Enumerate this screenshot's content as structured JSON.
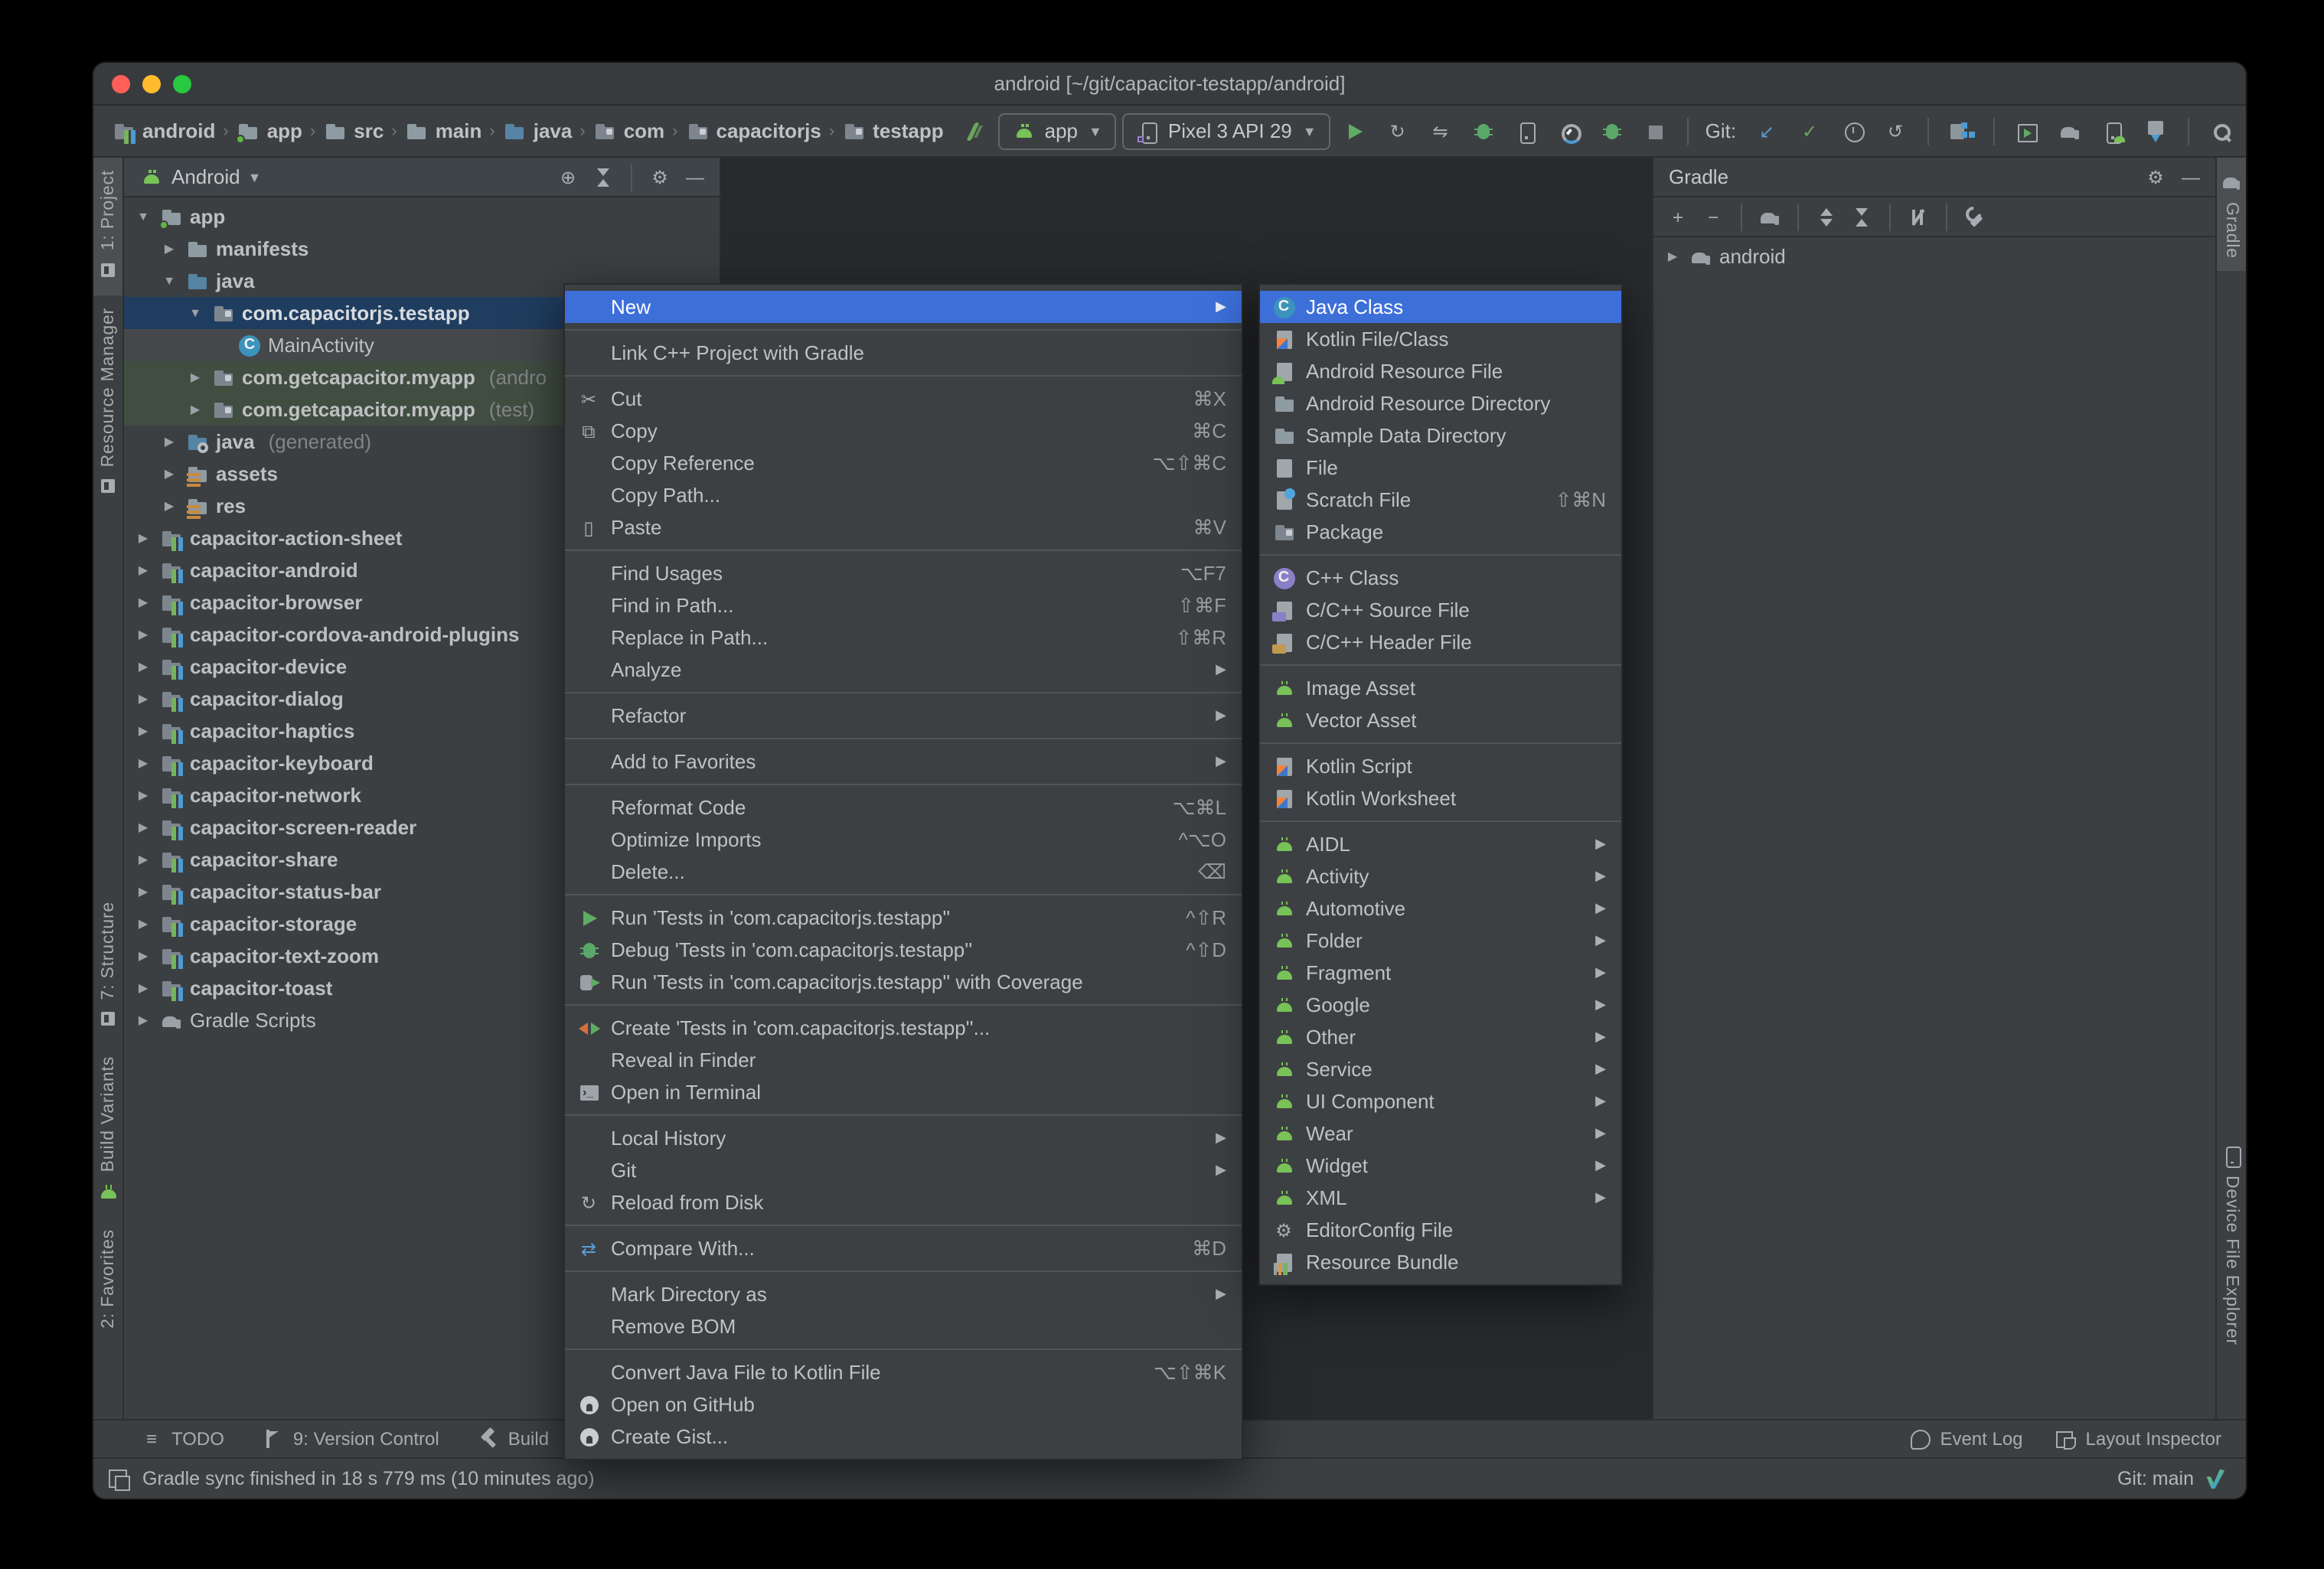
{
  "window": {
    "title": "android [~/git/capacitor-testapp/android]"
  },
  "toolbar": {
    "breadcrumbs": [
      {
        "label": "android",
        "icon": "module"
      },
      {
        "label": "app",
        "icon": "folder-run"
      },
      {
        "label": "src",
        "icon": "folder"
      },
      {
        "label": "main",
        "icon": "folder"
      },
      {
        "label": "java",
        "icon": "folder-src"
      },
      {
        "label": "com",
        "icon": "package"
      },
      {
        "label": "capacitorjs",
        "icon": "package"
      },
      {
        "label": "testapp",
        "icon": "package"
      }
    ],
    "run_config": {
      "label": "app",
      "icon": "android-head"
    },
    "device": {
      "label": "Pixel 3 API 29",
      "icon": "phone-virtual"
    },
    "run_icons": [
      {
        "name": "run",
        "icon": "play"
      },
      {
        "name": "apply-changes",
        "icon": "apply-changes"
      },
      {
        "name": "apply-code-changes",
        "icon": "apply-code-changes"
      },
      {
        "name": "debug",
        "icon": "bug"
      },
      {
        "name": "attach-debugger",
        "icon": "attach-debugger"
      },
      {
        "name": "profile",
        "icon": "profiler"
      },
      {
        "name": "profile-low-overhead",
        "icon": "bug"
      },
      {
        "name": "stop",
        "icon": "stop"
      }
    ],
    "git_label": "Git:",
    "vcs_icons": [
      {
        "name": "update-project",
        "icon": "arrow-down-left"
      },
      {
        "name": "commit",
        "icon": "check"
      },
      {
        "name": "history",
        "icon": "clock"
      },
      {
        "name": "rollback",
        "icon": "undo"
      }
    ],
    "structure_icon": {
      "name": "project-structure",
      "icon": "project-structure"
    },
    "manage_icons": [
      {
        "name": "avd-manager",
        "icon": "avd"
      },
      {
        "name": "sync-project-with-gradle",
        "icon": "elephant"
      },
      {
        "name": "device-manager",
        "icon": "device-manager"
      },
      {
        "name": "sdk-manager",
        "icon": "sdk"
      }
    ],
    "search": {
      "name": "search-everywhere",
      "icon": "search"
    },
    "avatar": {
      "name": "profile-avatar",
      "icon": "avatar"
    }
  },
  "left_stripe": {
    "top": [
      {
        "label": "1: Project",
        "icon": "project-tab",
        "active": true
      },
      {
        "label": "Resource Manager",
        "icon": "resource-manager-tab",
        "active": false
      }
    ],
    "bottom": [
      {
        "label": "7: Structure",
        "icon": "structure-tab",
        "active": false
      },
      {
        "label": "Build Variants",
        "icon": "build-variants-tab",
        "active": false
      },
      {
        "label": "2: Favorites",
        "icon": "favorites-tab",
        "active": false
      }
    ]
  },
  "right_stripe": {
    "top": [
      {
        "label": "Gradle",
        "icon": "elephant",
        "active": true
      }
    ],
    "bottom": [
      {
        "label": "Device File Explorer",
        "icon": "device-explorer-tab",
        "active": false
      }
    ]
  },
  "project_panel": {
    "view_selector": "Android",
    "header_icons": [
      "locate",
      "collapse-all",
      "divider",
      "gear",
      "minimize"
    ],
    "tree": [
      {
        "label": "app",
        "icon": "folder-run",
        "depth": 0,
        "chevron": "expanded",
        "bold": true
      },
      {
        "label": "manifests",
        "icon": "folder",
        "depth": 1,
        "chevron": "collapsed",
        "bold": true
      },
      {
        "label": "java",
        "icon": "folder-src",
        "depth": 1,
        "chevron": "expanded",
        "bold": true
      },
      {
        "label": "com.capacitorjs.testapp",
        "icon": "package",
        "depth": 2,
        "chevron": "expanded",
        "bold": true,
        "state": "selected"
      },
      {
        "label": "MainActivity",
        "icon": "class",
        "depth": 3,
        "chevron": "none",
        "state": "hover"
      },
      {
        "label": "com.getcapacitor.myapp",
        "suffix": "(andro",
        "icon": "package",
        "depth": 2,
        "chevron": "collapsed",
        "bold": true,
        "state": "test"
      },
      {
        "label": "com.getcapacitor.myapp",
        "suffix": "(test)",
        "icon": "package",
        "depth": 2,
        "chevron": "collapsed",
        "bold": true,
        "state": "test"
      },
      {
        "label": "java",
        "suffix": "(generated)",
        "icon": "folder-gen",
        "depth": 1,
        "chevron": "collapsed",
        "bold": true
      },
      {
        "label": "assets",
        "icon": "folder-assets",
        "depth": 1,
        "chevron": "collapsed",
        "bold": true
      },
      {
        "label": "res",
        "icon": "folder-assets",
        "depth": 1,
        "chevron": "collapsed",
        "bold": true
      },
      {
        "label": "capacitor-action-sheet",
        "icon": "module",
        "depth": 0,
        "chevron": "collapsed",
        "bold": true
      },
      {
        "label": "capacitor-android",
        "icon": "module",
        "depth": 0,
        "chevron": "collapsed",
        "bold": true
      },
      {
        "label": "capacitor-browser",
        "icon": "module",
        "depth": 0,
        "chevron": "collapsed",
        "bold": true
      },
      {
        "label": "capacitor-cordova-android-plugins",
        "icon": "module",
        "depth": 0,
        "chevron": "collapsed",
        "bold": true
      },
      {
        "label": "capacitor-device",
        "icon": "module",
        "depth": 0,
        "chevron": "collapsed",
        "bold": true
      },
      {
        "label": "capacitor-dialog",
        "icon": "module",
        "depth": 0,
        "chevron": "collapsed",
        "bold": true
      },
      {
        "label": "capacitor-haptics",
        "icon": "module",
        "depth": 0,
        "chevron": "collapsed",
        "bold": true
      },
      {
        "label": "capacitor-keyboard",
        "icon": "module",
        "depth": 0,
        "chevron": "collapsed",
        "bold": true
      },
      {
        "label": "capacitor-network",
        "icon": "module",
        "depth": 0,
        "chevron": "collapsed",
        "bold": true
      },
      {
        "label": "capacitor-screen-reader",
        "icon": "module",
        "depth": 0,
        "chevron": "collapsed",
        "bold": true
      },
      {
        "label": "capacitor-share",
        "icon": "module",
        "depth": 0,
        "chevron": "collapsed",
        "bold": true
      },
      {
        "label": "capacitor-status-bar",
        "icon": "module",
        "depth": 0,
        "chevron": "collapsed",
        "bold": true
      },
      {
        "label": "capacitor-storage",
        "icon": "module",
        "depth": 0,
        "chevron": "collapsed",
        "bold": true
      },
      {
        "label": "capacitor-text-zoom",
        "icon": "module",
        "depth": 0,
        "chevron": "collapsed",
        "bold": true
      },
      {
        "label": "capacitor-toast",
        "icon": "module",
        "depth": 0,
        "chevron": "collapsed",
        "bold": true
      },
      {
        "label": "Gradle Scripts",
        "icon": "elephant",
        "depth": 0,
        "chevron": "collapsed"
      }
    ]
  },
  "gradle_panel": {
    "title": "Gradle",
    "header_icons": [
      "gear",
      "minimize"
    ],
    "toolbar_icons": [
      "plus",
      "minus",
      "divider",
      "elephant",
      "divider",
      "expand-all",
      "collapse-all",
      "divider",
      "run-task",
      "divider",
      "wrench"
    ],
    "tree": [
      {
        "label": "android",
        "icon": "elephant",
        "depth": 0,
        "chevron": "collapsed"
      }
    ]
  },
  "context_menu": {
    "items": [
      {
        "label": "New",
        "submenu": true,
        "selected": true
      },
      {
        "type": "sep"
      },
      {
        "label": "Link C++ Project with Gradle"
      },
      {
        "type": "sep"
      },
      {
        "label": "Cut",
        "icon": "scissors",
        "shortcut": "⌘X"
      },
      {
        "label": "Copy",
        "icon": "copy",
        "shortcut": "⌘C"
      },
      {
        "label": "Copy Reference",
        "shortcut": "⌥⇧⌘C"
      },
      {
        "label": "Copy Path..."
      },
      {
        "label": "Paste",
        "icon": "paste",
        "shortcut": "⌘V"
      },
      {
        "type": "sep"
      },
      {
        "label": "Find Usages",
        "shortcut": "⌥F7"
      },
      {
        "label": "Find in Path...",
        "shortcut": "⇧⌘F"
      },
      {
        "label": "Replace in Path...",
        "shortcut": "⇧⌘R"
      },
      {
        "label": "Analyze",
        "submenu": true
      },
      {
        "type": "sep"
      },
      {
        "label": "Refactor",
        "submenu": true
      },
      {
        "type": "sep"
      },
      {
        "label": "Add to Favorites",
        "submenu": true
      },
      {
        "type": "sep"
      },
      {
        "label": "Reformat Code",
        "shortcut": "⌥⌘L"
      },
      {
        "label": "Optimize Imports",
        "shortcut": "^⌥O"
      },
      {
        "label": "Delete...",
        "shortcut": "⌫"
      },
      {
        "type": "sep"
      },
      {
        "label": "Run 'Tests in 'com.capacitorjs.testapp''",
        "icon": "play",
        "shortcut": "^⇧R"
      },
      {
        "label": "Debug 'Tests in 'com.capacitorjs.testapp''",
        "icon": "bug",
        "shortcut": "^⇧D"
      },
      {
        "label": "Run 'Tests in 'com.capacitorjs.testapp'' with Coverage",
        "icon": "coverage"
      },
      {
        "type": "sep"
      },
      {
        "label": "Create 'Tests in 'com.capacitorjs.testapp''...",
        "icon": "create-tests"
      },
      {
        "label": "Reveal in Finder"
      },
      {
        "label": "Open in Terminal",
        "icon": "terminal"
      },
      {
        "type": "sep"
      },
      {
        "label": "Local History",
        "submenu": true
      },
      {
        "label": "Git",
        "submenu": true
      },
      {
        "label": "Reload from Disk",
        "icon": "reload"
      },
      {
        "type": "sep"
      },
      {
        "label": "Compare With...",
        "icon": "compare",
        "shortcut": "⌘D"
      },
      {
        "type": "sep"
      },
      {
        "label": "Mark Directory as",
        "submenu": true
      },
      {
        "label": "Remove BOM"
      },
      {
        "type": "sep"
      },
      {
        "label": "Convert Java File to Kotlin File",
        "shortcut": "⌥⇧⌘K"
      },
      {
        "label": "Open on GitHub",
        "icon": "github"
      },
      {
        "label": "Create Gist...",
        "icon": "github"
      }
    ]
  },
  "new_submenu": {
    "items": [
      {
        "label": "Java Class",
        "icon": "java-class",
        "selected": true
      },
      {
        "label": "Kotlin File/Class",
        "icon": "kotlin"
      },
      {
        "label": "Android Resource File",
        "icon": "android-resource-file"
      },
      {
        "label": "Android Resource Directory",
        "icon": "folder"
      },
      {
        "label": "Sample Data Directory",
        "icon": "folder"
      },
      {
        "label": "File",
        "icon": "file"
      },
      {
        "label": "Scratch File",
        "icon": "scratch-file",
        "shortcut": "⇧⌘N"
      },
      {
        "label": "Package",
        "icon": "package"
      },
      {
        "type": "sep"
      },
      {
        "label": "C++ Class",
        "icon": "cpp-class"
      },
      {
        "label": "C/C++ Source File",
        "icon": "cpp-source"
      },
      {
        "label": "C/C++ Header File",
        "icon": "cpp-header"
      },
      {
        "type": "sep"
      },
      {
        "label": "Image Asset",
        "icon": "android-head"
      },
      {
        "label": "Vector Asset",
        "icon": "android-head"
      },
      {
        "type": "sep"
      },
      {
        "label": "Kotlin Script",
        "icon": "kotlin"
      },
      {
        "label": "Kotlin Worksheet",
        "icon": "kotlin"
      },
      {
        "type": "sep"
      },
      {
        "label": "AIDL",
        "icon": "android-head",
        "submenu": true
      },
      {
        "label": "Activity",
        "icon": "android-head",
        "submenu": true
      },
      {
        "label": "Automotive",
        "icon": "android-head",
        "submenu": true
      },
      {
        "label": "Folder",
        "icon": "android-head",
        "submenu": true
      },
      {
        "label": "Fragment",
        "icon": "android-head",
        "submenu": true
      },
      {
        "label": "Google",
        "icon": "android-head",
        "submenu": true
      },
      {
        "label": "Other",
        "icon": "android-head",
        "submenu": true
      },
      {
        "label": "Service",
        "icon": "android-head",
        "submenu": true
      },
      {
        "label": "UI Component",
        "icon": "android-head",
        "submenu": true
      },
      {
        "label": "Wear",
        "icon": "android-head",
        "submenu": true
      },
      {
        "label": "Widget",
        "icon": "android-head",
        "submenu": true
      },
      {
        "label": "XML",
        "icon": "android-head",
        "submenu": true
      },
      {
        "label": "EditorConfig File",
        "icon": "editorconfig"
      },
      {
        "label": "Resource Bundle",
        "icon": "resource-bundle"
      }
    ]
  },
  "bottom_bar": {
    "left": [
      {
        "label": "TODO",
        "icon": "todo"
      },
      {
        "label": "9: Version Control",
        "icon": "version-control"
      },
      {
        "label": "Build",
        "icon": "build"
      }
    ],
    "right": [
      {
        "label": "Event Log",
        "icon": "event-log"
      },
      {
        "label": "Layout Inspector",
        "icon": "layout-inspector"
      }
    ]
  },
  "status_bar": {
    "message": "Gradle sync finished in 18 s 779 ms (10 minutes ago)",
    "git_branch": "Git: main"
  },
  "colors": {
    "menu_selection": "#3d6fd9",
    "tree_selection": "#1f3d5f",
    "test_source_row": "#404d41",
    "accent_green": "#5fad65",
    "panel_bg": "#3c3f41",
    "editor_bg": "#282a2c"
  }
}
